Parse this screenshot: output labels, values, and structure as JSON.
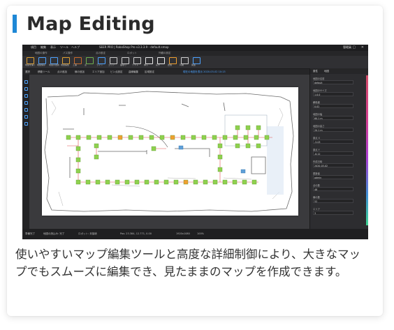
{
  "heading": {
    "title": "Map Editing",
    "accent_color": "#1e88d6"
  },
  "caption": "使いやすいマップ編集ツールと高度な詳細制御により、大きなマップでもスムーズに編集でき、見たままのマップを作成できます。",
  "screenshot": {
    "menu": [
      "項目",
      "編集",
      "表示",
      "ツール",
      "ヘルプ"
    ],
    "window_title": "SEER PRO  |  RoboShop Pro v3.3.3.9 - default.smap",
    "user": "管理員",
    "ribbon_groups": [
      "地図の操作",
      "パス操作",
      "点の設定",
      "ロボット",
      "外観の設定"
    ],
    "ribbon_buttons": [
      "地図を開く",
      "地図保存",
      "地図の更新",
      "地図編集",
      "工事",
      "点",
      "ライン",
      "エリア",
      "面取り",
      "テスト",
      "挿入",
      "戻す",
      "送信",
      "同期",
      "関連"
    ],
    "subbar": [
      "選択",
      "移動ツール",
      "点の追加",
      "線の追加",
      "エリア追加",
      "ビン点設定",
      "曲線編集",
      "区域設定"
    ],
    "subbar_highlight": "現在の地図を表示   2020-03-02 10:13",
    "right_panel": {
      "tabs": [
        "属性",
        "地図"
      ],
      "props": [
        {
          "label": "地図の名前",
          "value": "default"
        },
        {
          "label": "地図のサイズ",
          "value": "1.0.0"
        },
        {
          "label": "解像度",
          "value": "0.02"
        },
        {
          "label": "地図の幅",
          "value": "60.1 m"
        },
        {
          "label": "地図の高さ",
          "value": "20.1 m"
        },
        {
          "label": "原点 X",
          "value": "-5.03"
        },
        {
          "label": "原点 Y",
          "value": "-6.12"
        },
        {
          "label": "作成日時",
          "value": "2020-03-02"
        },
        {
          "label": "更新者",
          "value": "admin"
        },
        {
          "label": "点の数",
          "value": "48"
        },
        {
          "label": "線の数",
          "value": "52"
        },
        {
          "label": "エリア",
          "value": "3"
        }
      ]
    },
    "statusbar": [
      "準備完了",
      "地図の読込み: 完了",
      "ロボット: 未接続",
      "Pos: 23.384, 12.771, 0.00",
      "1920x1080",
      "100%"
    ],
    "colors": {
      "node": "#8fd14f",
      "node_selected": "#f0a030",
      "path": "#e05050",
      "accent": "#4da3ff"
    }
  }
}
